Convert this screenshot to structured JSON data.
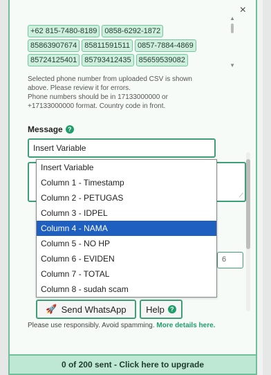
{
  "phones": [
    [
      "+62 815-7480-8189",
      "0858-6292-1872"
    ],
    [
      "85863907674",
      "85811591511",
      "0857-7884-4869"
    ],
    [
      "85724125401",
      "85793412435",
      "85659539082"
    ]
  ],
  "note_lines": [
    "Selected phone number from uploaded CSV is shown",
    "above. Please review it for errors.",
    "Phone numbers should be in 17133000000 or",
    "+17133000000 format. Country code in front."
  ],
  "message_label": "Message",
  "message_help_icon": "help-circle-icon",
  "variable_select_value": "Insert Variable",
  "dropdown_options": [
    "Insert Variable",
    "Column 1 - Timestamp",
    "Column 2 - PETUGAS",
    "Column 3 - IDPEL",
    "Column 4 - NAMA",
    "Column 5 - NO HP",
    "Column 6 - EVIDEN",
    "Column 7 - TOTAL",
    "Column 8 - sudah scam"
  ],
  "selected_option_index": 4,
  "side_input_value": "6",
  "send_button_label": "Send WhatsApp",
  "help_button_label": "Help",
  "notice_text": "Please use responsibly. Avoid spamming.",
  "notice_link": "More details here.",
  "footer_text": "0 of 200 sent - Click here to upgrade",
  "close_symbol": "×",
  "colors": {
    "accent": "#3d9e78",
    "chip_bg": "#cfeedd",
    "footer_bg": "#bfe8d4",
    "selected_bg": "#1f5fbf"
  }
}
